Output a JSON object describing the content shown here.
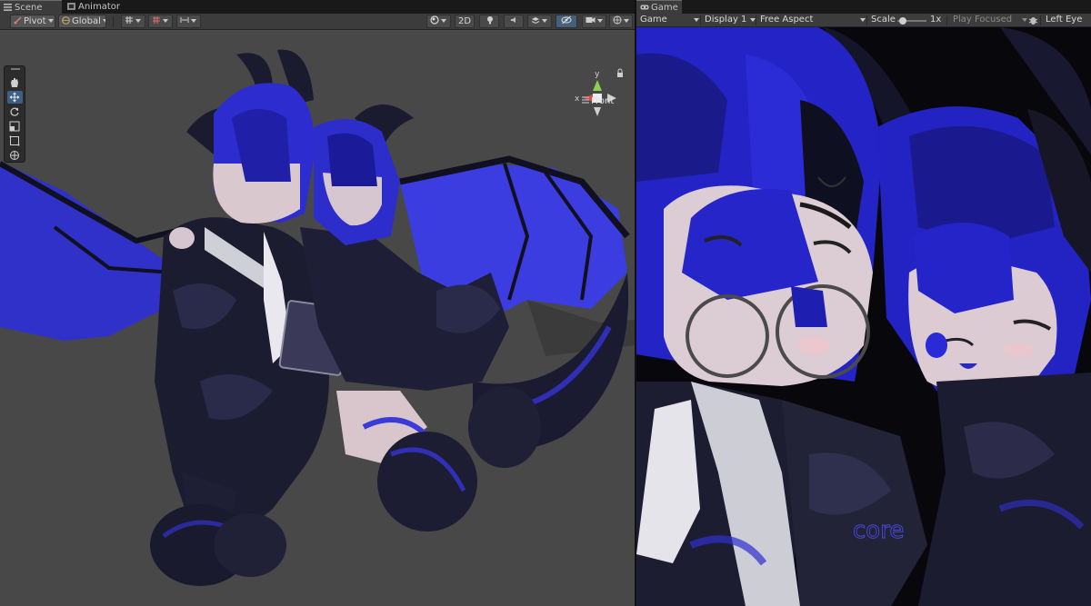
{
  "window": {
    "scene_tab": "Scene",
    "animator_tab": "Animator",
    "game_tab": "Game"
  },
  "scene_toolbar": {
    "pivot_label": "Pivot",
    "global_label": "Global",
    "mode_2d_label": "2D"
  },
  "scene_gizmo": {
    "view_label": "Front",
    "x_axis": "x",
    "y_axis": "y"
  },
  "game_toolbar": {
    "display_type": "Game",
    "display": "Display 1",
    "aspect": "Free Aspect",
    "scale_label": "Scale",
    "scale_value": "1x",
    "scale_level": 0.1,
    "play_mode": "Play Focused",
    "eye": "Left Eye"
  },
  "colors": {
    "editor_bg": "#191919",
    "panel_bg": "#3c3c3c",
    "scene_bg": "#484848",
    "selection": "#46607c",
    "character_blue": "#2b2bd8",
    "character_dark": "#1d1d33"
  },
  "icons": [
    "scene-tab-icon",
    "animator-tab-icon",
    "game-tab-icon",
    "hand-tool-icon",
    "move-tool-icon",
    "rotate-tool-icon",
    "scale-tool-icon",
    "rect-tool-icon",
    "transform-tool-icon",
    "lock-icon",
    "bug-icon"
  ]
}
